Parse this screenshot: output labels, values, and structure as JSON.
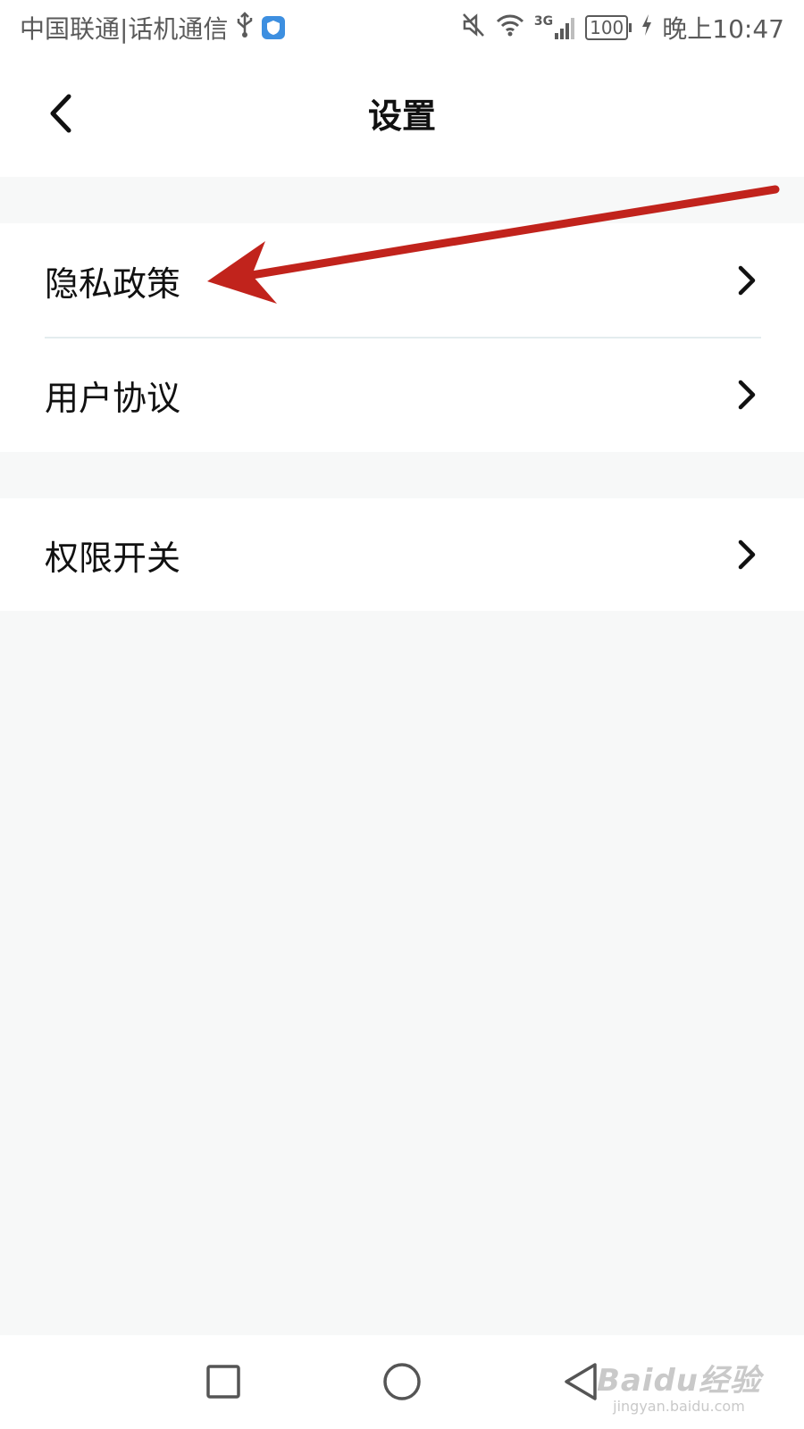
{
  "status_bar": {
    "carrier": "中国联通|话机通信",
    "network": "3G",
    "battery": "100",
    "time": "晚上10:47"
  },
  "header": {
    "title": "设置"
  },
  "settings": {
    "groups": [
      {
        "items": [
          {
            "label": "隐私政策"
          },
          {
            "label": "用户协议"
          }
        ]
      },
      {
        "items": [
          {
            "label": "权限开关"
          }
        ]
      }
    ]
  },
  "icons": {
    "back": "back-chevron-icon",
    "chevron": "chevron-right-icon",
    "usb": "usb-icon",
    "shield": "shield-icon",
    "mute": "mute-icon",
    "wifi": "wifi-icon",
    "signal": "signal-icon",
    "charging": "charging-icon",
    "nav_recent": "square-icon",
    "nav_home": "circle-icon",
    "nav_back": "triangle-back-icon"
  },
  "watermark": {
    "brand": "Baidu经验",
    "url": "jingyan.baidu.com"
  },
  "colors": {
    "background": "#f7f8f8",
    "surface": "#ffffff",
    "text": "#111111",
    "divider": "#e3ecee",
    "annotation_arrow": "#c1231c",
    "shield_badge": "#3d8fe0"
  }
}
